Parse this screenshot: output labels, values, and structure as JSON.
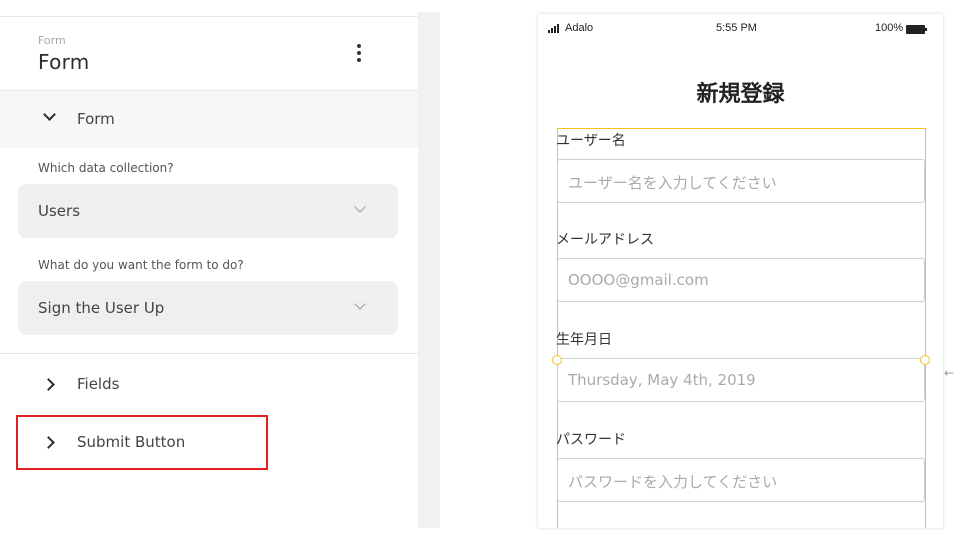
{
  "panel": {
    "header_small": "Form",
    "header_title": "Form",
    "section_title": "Form",
    "collection_label": "Which data collection?",
    "collection_value": "Users",
    "action_label": "What do you want the form to do?",
    "action_value": "Sign the User Up",
    "sections": [
      {
        "label": "Fields"
      },
      {
        "label": "Submit Button"
      }
    ]
  },
  "phone": {
    "status": {
      "carrier": "Adalo",
      "time": "5:55 PM",
      "battery": "100%"
    },
    "title": "新規登録",
    "fields": [
      {
        "label": "ユーザー名",
        "placeholder": "ユーザー名を入力してください"
      },
      {
        "label": "メールアドレス",
        "placeholder": "OOOO@gmail.com"
      },
      {
        "label": "生年月日",
        "placeholder": "Thursday, May 4th, 2019"
      },
      {
        "label": "パスワード",
        "placeholder": "パスワードを入力してください"
      }
    ]
  },
  "colors": {
    "selection": "#f5c218",
    "highlight": "#e02020",
    "select_bg": "#efefef"
  }
}
